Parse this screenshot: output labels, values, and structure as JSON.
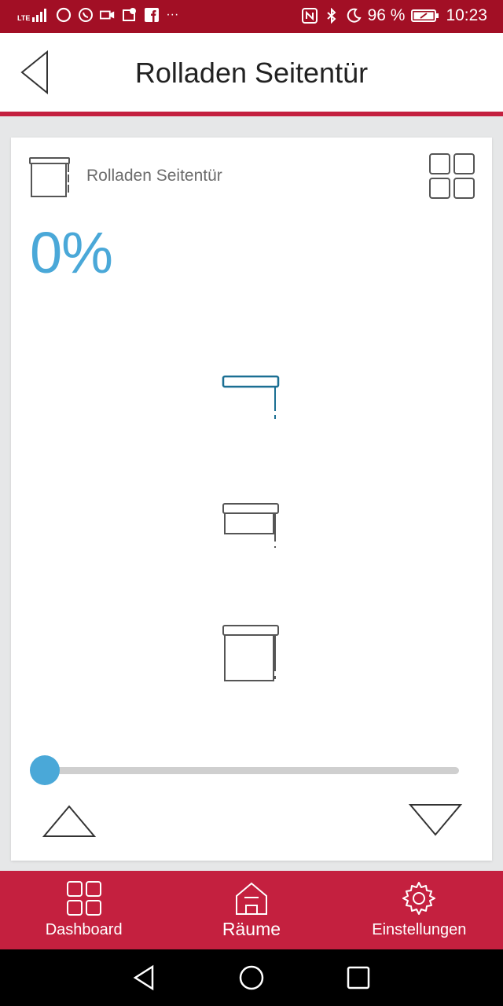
{
  "status_bar": {
    "network": "LTE",
    "battery_percent": "96 %",
    "time": "10:23",
    "overflow": "···",
    "background_color": "#a20f25"
  },
  "header": {
    "title": "Rolladen Seitentür",
    "back_icon": "chevron-left-icon",
    "accent_color": "#c4203f"
  },
  "device": {
    "name": "Rolladen Seitentür",
    "icon": "roller-shutter-icon",
    "position_text": "0%",
    "position_value": 0,
    "accent_color": "#4aa8d8",
    "positions": [
      "open",
      "half",
      "closed"
    ]
  },
  "slider": {
    "value": 0,
    "min": 0,
    "max": 100
  },
  "controls": {
    "up_icon": "triangle-up-icon",
    "down_icon": "triangle-down-icon"
  },
  "bottom_nav": {
    "items": [
      {
        "label": "Dashboard",
        "icon": "grid-icon",
        "active": false
      },
      {
        "label": "Räume",
        "icon": "house-icon",
        "active": true
      },
      {
        "label": "Einstellungen",
        "icon": "gear-icon",
        "active": false
      }
    ],
    "background_color": "#c4203f"
  },
  "system_nav": {
    "back": "back-icon",
    "home": "home-icon",
    "recents": "recents-icon"
  }
}
